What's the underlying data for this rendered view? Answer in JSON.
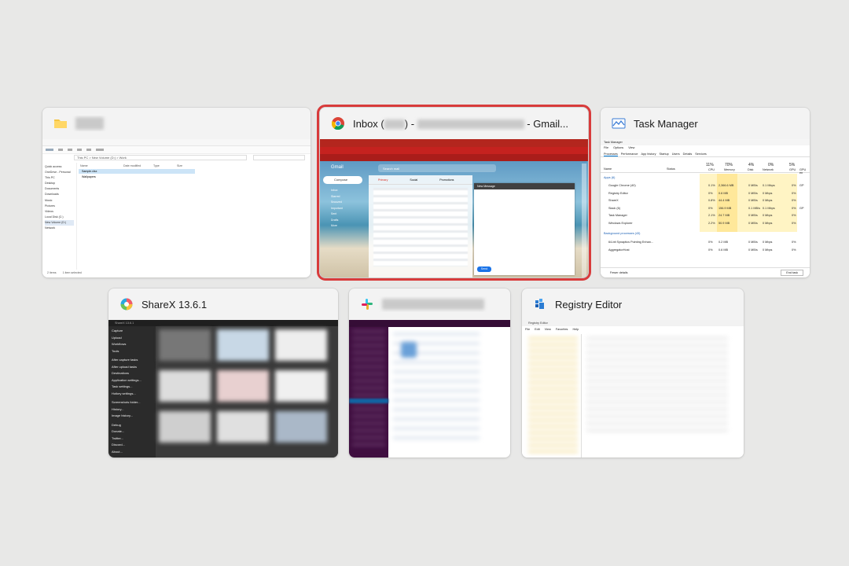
{
  "windows": [
    {
      "id": "file-explorer",
      "title": "",
      "icon": "folder-icon",
      "preview": {
        "address": [
          "This PC",
          "New Volume (D:)",
          "Work"
        ],
        "columns": [
          "Name",
          "Date modified",
          "Type",
          "Size"
        ],
        "files": [
          "Sample.xlsx",
          "Wallpapers"
        ],
        "nav_items": [
          "Quick access",
          "OneDrive - Personal",
          "This PC",
          "Desktop",
          "Documents",
          "Downloads",
          "Music",
          "Pictures",
          "Videos",
          "Local Disk (C:)",
          "New Volume (D:)",
          "Network"
        ],
        "status": [
          "2 items",
          "1 item selected"
        ]
      }
    },
    {
      "id": "chrome-gmail",
      "title_prefix": "Inbox (",
      "title_middle": ") - ",
      "title_suffix": " - Gmail...",
      "icon": "chrome-icon",
      "selected": true,
      "preview": {
        "search_placeholder": "Search mail",
        "compose_label": "Compose",
        "logo": "Gmail",
        "labels": [
          "Inbox",
          "Starred",
          "Snoozed",
          "Important",
          "Sent",
          "Drafts",
          "More"
        ],
        "tabs": [
          "Primary",
          "Social",
          "Promotions"
        ],
        "new_message": "New Message",
        "send": "Send"
      }
    },
    {
      "id": "task-manager",
      "title": "Task Manager",
      "icon": "task-manager-icon",
      "preview": {
        "menu": [
          "File",
          "Options",
          "View"
        ],
        "tabs": [
          "Processes",
          "Performance",
          "App history",
          "Startup",
          "Users",
          "Details",
          "Services"
        ],
        "headers": {
          "name": "Name",
          "status": "Status",
          "cpu_pct": "11%",
          "cpu": "CPU",
          "mem_pct": "70%",
          "mem": "Memory",
          "disk_pct": "4%",
          "disk": "Disk",
          "net_pct": "0%",
          "net": "Network",
          "gpu_pct": "5%",
          "gpu": "GPU",
          "gpu_engine": "GPU en"
        },
        "apps_group": "Apps (6)",
        "apps": [
          {
            "name": "Google Chrome (40)",
            "cpu": "0.1%",
            "mem": "2,366.6 MB",
            "disk": "0 MB/s",
            "net": "0.1 Mbps",
            "gpu": "0%",
            "engine": "GP"
          },
          {
            "name": "Registry Editor",
            "cpu": "0%",
            "mem": "0.6 MB",
            "disk": "0 MB/s",
            "net": "0 Mbps",
            "gpu": "0%",
            "engine": ""
          },
          {
            "name": "ShareX",
            "cpu": "0.8%",
            "mem": "44.4 MB",
            "disk": "0 MB/s",
            "net": "0 Mbps",
            "gpu": "0%",
            "engine": ""
          },
          {
            "name": "Slack (6)",
            "cpu": "0%",
            "mem": "156.9 MB",
            "disk": "0.1 MB/s",
            "net": "0.1 Mbps",
            "gpu": "0%",
            "engine": "GP"
          },
          {
            "name": "Task Manager",
            "cpu": "2.1%",
            "mem": "24.7 MB",
            "disk": "0 MB/s",
            "net": "0 Mbps",
            "gpu": "0%",
            "engine": ""
          },
          {
            "name": "Windows Explorer",
            "cpu": "2.2%",
            "mem": "50.9 MB",
            "disk": "0 MB/s",
            "net": "0 Mbps",
            "gpu": "0%",
            "engine": ""
          }
        ],
        "bg_group": "Background processes (43)",
        "bg": [
          {
            "name": "64-bit Synaptics Pointing Enhan...",
            "cpu": "0%",
            "mem": "0.2 MB",
            "disk": "0 MB/s",
            "net": "0 Mbps",
            "gpu": "0%"
          },
          {
            "name": "AggregatorHost",
            "cpu": "0%",
            "mem": "0.6 MB",
            "disk": "0 MB/s",
            "net": "0 Mbps",
            "gpu": "0%"
          }
        ],
        "fewer_details": "Fewer details",
        "end_task": "End task"
      }
    },
    {
      "id": "sharex",
      "title": "ShareX 13.6.1",
      "icon": "sharex-icon",
      "preview": {
        "window_title": "ShareX 13.6.1",
        "menu": [
          "Capture",
          "Upload",
          "Workflows",
          "Tools",
          "After capture tasks",
          "After upload tasks",
          "Destinations",
          "Application settings...",
          "Task settings...",
          "Hotkey settings...",
          "Screenshots folder...",
          "History...",
          "Image history...",
          "Debug",
          "Donate...",
          "Twitter...",
          "Discord...",
          "About..."
        ]
      }
    },
    {
      "id": "slack",
      "title": "",
      "icon": "slack-icon",
      "preview": {}
    },
    {
      "id": "registry-editor",
      "title": "Registry Editor",
      "icon": "registry-editor-icon",
      "preview": {
        "window_title": "Registry Editor",
        "menu": [
          "File",
          "Edit",
          "View",
          "Favorites",
          "Help"
        ]
      }
    }
  ],
  "colors": {
    "background": "#e8e8e7",
    "selection": "#d83b3b",
    "gmail_red": "#c5221f",
    "sharex_bg": "#2b2b2b",
    "slack_purple": "#3f0e40",
    "taskmgr_yellow": "#fff3c4"
  }
}
